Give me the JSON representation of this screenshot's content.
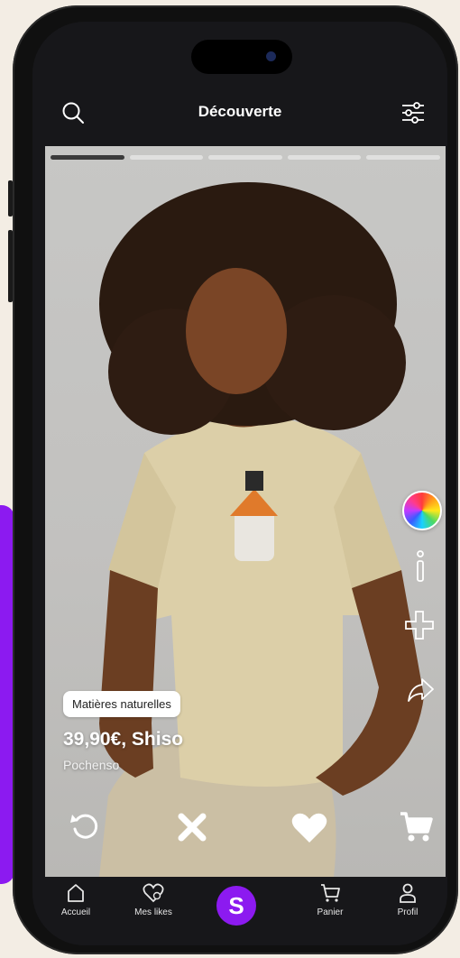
{
  "header": {
    "title": "Découverte"
  },
  "story": {
    "segments": 5,
    "active_index": 0
  },
  "product": {
    "tag": "Matières naturelles",
    "price_line": "39,90€, Shiso",
    "brand": "Pochenso"
  },
  "icons": {
    "search": "search-icon",
    "filter": "sliders-icon",
    "color": "color-wheel-icon",
    "info": "info-icon",
    "add": "plus-icon",
    "share": "share-icon",
    "undo": "undo-icon",
    "dislike": "close-icon",
    "like": "heart-icon",
    "cart": "cart-icon"
  },
  "bottom_nav": {
    "items": [
      {
        "label": "Accueil",
        "icon": "home-icon"
      },
      {
        "label": "Mes likes",
        "icon": "heart-plus-icon"
      },
      {
        "label": "S",
        "icon": "logo-s"
      },
      {
        "label": "Panier",
        "icon": "cart-icon"
      },
      {
        "label": "Profil",
        "icon": "user-icon"
      }
    ]
  },
  "colors": {
    "accent": "#8c1af0",
    "page_background": "#f3ede4",
    "phone_frame": "#101010"
  }
}
